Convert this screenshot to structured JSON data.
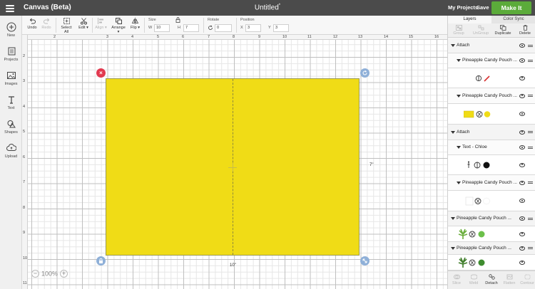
{
  "header": {
    "app_title": "Canvas (Beta)",
    "doc_title": "Untitled",
    "unsaved_mark": "*",
    "my_projects": "My Projects",
    "save": "Save",
    "make_it": "Make It",
    "make_it_color": "#5bab3a"
  },
  "sidebar": {
    "items": [
      {
        "label": "New",
        "icon": "plus-circle-icon"
      },
      {
        "label": "Projects",
        "icon": "projects-icon"
      },
      {
        "label": "Images",
        "icon": "images-icon"
      },
      {
        "label": "Text",
        "icon": "text-icon"
      },
      {
        "label": "Shapes",
        "icon": "shapes-icon"
      },
      {
        "label": "Upload",
        "icon": "upload-icon"
      }
    ]
  },
  "toolbar": {
    "undo": "Undo",
    "redo": "Redo",
    "select_all": "Select All",
    "edit": "Edit",
    "align": "Align",
    "arrange": "Arrange",
    "flip": "Flip",
    "size_label": "Size",
    "w_label": "W",
    "w_value": "10",
    "h_label": "H",
    "h_value": "7",
    "rotate_label": "Rotate",
    "rotate_value": "0",
    "position_label": "Position",
    "x_label": "X",
    "x_value": "3",
    "y_label": "Y",
    "y_value": "3"
  },
  "canvas": {
    "ruler_top": [
      "2",
      "3",
      "4",
      "5",
      "6",
      "7",
      "8",
      "9",
      "10",
      "11",
      "12",
      "13",
      "14",
      "15",
      "16"
    ],
    "ruler_left": [
      "2",
      "3",
      "4",
      "5",
      "6",
      "7",
      "8",
      "9",
      "10",
      "11"
    ],
    "shape_color": "#f0dc16",
    "width_label": "10\"",
    "height_label": "7\"",
    "zoom": "100%",
    "zoom_out": "−",
    "zoom_in": "+"
  },
  "panel": {
    "tab_layers": "Layers",
    "tab_color_sync": "Color Sync",
    "tools": [
      "Group",
      "UnGroup",
      "Duplicate",
      "Delete"
    ],
    "bottom_tools": [
      "Slice",
      "Weld",
      "Detach",
      "Flatten",
      "Contour"
    ],
    "rows": [
      {
        "type": "group",
        "label": "Attach"
      },
      {
        "type": "sub",
        "label": "Pineapple Candy Pouch ..."
      },
      {
        "type": "thumbs",
        "items": [
          "scissors-icon",
          "pen-icon"
        ]
      },
      {
        "type": "sub",
        "label": "Pineapple Candy Pouch ..."
      },
      {
        "type": "thumbs",
        "items": [
          "yellow-rect",
          "scissors-icon",
          "yellow-dot"
        ]
      },
      {
        "type": "group",
        "label": "Attach"
      },
      {
        "type": "sub",
        "label": "Text - Chloe"
      },
      {
        "type": "thumbs",
        "items": [
          "figure-icon",
          "scissors-icon",
          "black-dot"
        ]
      },
      {
        "type": "sub",
        "label": "Pineapple Candy Pouch ..."
      },
      {
        "type": "thumbs",
        "items": [
          "white-swatch",
          "scissors-icon",
          "white-dot"
        ]
      },
      {
        "type": "group2",
        "label": "Pineapple Candy Pouch ..."
      },
      {
        "type": "thumbs",
        "items": [
          "green-leaf-icon",
          "scissors-icon",
          "green-dot"
        ]
      },
      {
        "type": "group2",
        "label": "Pineapple Candy Pouch ..."
      },
      {
        "type": "thumbs",
        "items": [
          "dark-leaf-icon",
          "scissors-icon",
          "dark-green-dot"
        ]
      }
    ]
  }
}
